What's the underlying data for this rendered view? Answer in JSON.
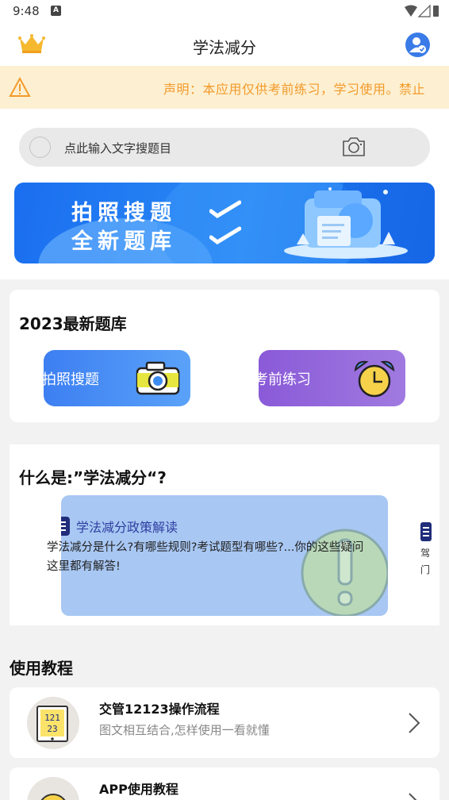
{
  "status": {
    "time": "9:48",
    "notif_icon": "A"
  },
  "appbar": {
    "title": "学法减分",
    "left_icon": "crown-icon",
    "right_icon": "user-avatar-icon"
  },
  "notice": {
    "text": "声明：本应用仅供考前练习，学习使用。禁止",
    "icon": "warning-icon",
    "color": "#f39a2b"
  },
  "search": {
    "placeholder": "点此输入文字搜题目"
  },
  "banner": {
    "line1": "拍照搜题",
    "line2": "全新题库"
  },
  "question_bank": {
    "title": "2023最新题库",
    "buttons": [
      {
        "label": "拍照搜题",
        "icon": "camera-icon"
      },
      {
        "label": "考前练习",
        "icon": "alarm-clock-icon"
      }
    ]
  },
  "what_is": {
    "title": "什么是:”学法减分“?",
    "card": {
      "title": "学法减分政策解读",
      "desc": "学法减分是什么?有哪些规则?考试题型有哪些?...你的这些疑问这里都有解答!"
    },
    "peek": [
      "驾",
      "门"
    ]
  },
  "tutorials": {
    "title": "使用教程",
    "items": [
      {
        "title": "交管12123操作流程",
        "subtitle": "图文相互结合,怎样使用一看就懂",
        "thumb_text": "121\n23"
      },
      {
        "title": "APP使用教程",
        "subtitle": ""
      }
    ]
  },
  "colors": {
    "accent": "#3a7be8",
    "notice_bg": "#fdf0d2",
    "purple": "#8c5fd6"
  }
}
